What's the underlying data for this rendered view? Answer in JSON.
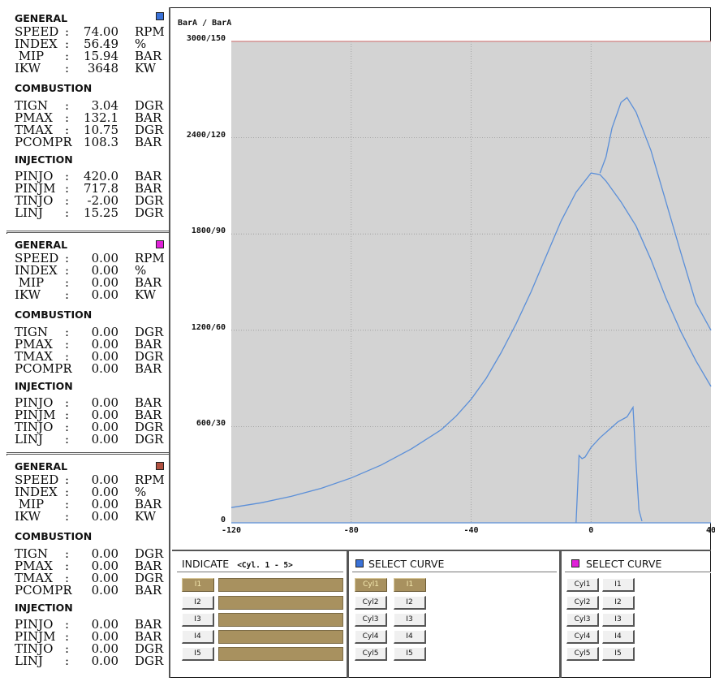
{
  "panels": [
    {
      "color": "#3a72d8",
      "general_label": "GENERAL",
      "general": [
        {
          "name": "SPEED",
          "value": "74.00",
          "unit": "RPM"
        },
        {
          "name": "INDEX",
          "value": "56.49",
          "unit": "%"
        },
        {
          "name": " MIP",
          "value": "15.94",
          "unit": "BAR"
        },
        {
          "name": "IKW",
          "value": "3648",
          "unit": "KW"
        }
      ],
      "combustion_label": "COMBUSTION",
      "combustion": [
        {
          "name": "TIGN",
          "value": "3.04",
          "unit": "DGR"
        },
        {
          "name": "PMAX",
          "value": "132.1",
          "unit": "BAR"
        },
        {
          "name": "TMAX",
          "value": "10.75",
          "unit": "DGR"
        },
        {
          "name": "PCOMPR",
          "value": "108.3",
          "unit": "BAR"
        }
      ],
      "injection_label": "INJECTION",
      "injection": [
        {
          "name": "PINJO",
          "value": "420.0",
          "unit": "BAR"
        },
        {
          "name": "PINJM",
          "value": "717.8",
          "unit": "BAR"
        },
        {
          "name": "TINJO",
          "value": "-2.00",
          "unit": "DGR"
        },
        {
          "name": "LINJ",
          "value": "15.25",
          "unit": "DGR"
        }
      ]
    },
    {
      "color": "#e020d8",
      "general_label": "GENERAL",
      "general": [
        {
          "name": "SPEED",
          "value": "0.00",
          "unit": "RPM"
        },
        {
          "name": "INDEX",
          "value": "0.00",
          "unit": "%"
        },
        {
          "name": " MIP",
          "value": "0.00",
          "unit": "BAR"
        },
        {
          "name": "IKW",
          "value": "0.00",
          "unit": "KW"
        }
      ],
      "combustion_label": "COMBUSTION",
      "combustion": [
        {
          "name": "TIGN",
          "value": "0.00",
          "unit": "DGR"
        },
        {
          "name": "PMAX",
          "value": "0.00",
          "unit": "BAR"
        },
        {
          "name": "TMAX",
          "value": "0.00",
          "unit": "DGR"
        },
        {
          "name": "PCOMPR",
          "value": "0.00",
          "unit": "BAR"
        }
      ],
      "injection_label": "INJECTION",
      "injection": [
        {
          "name": "PINJO",
          "value": "0.00",
          "unit": "BAR"
        },
        {
          "name": "PINJM",
          "value": "0.00",
          "unit": "BAR"
        },
        {
          "name": "TINJO",
          "value": "0.00",
          "unit": "DGR"
        },
        {
          "name": "LINJ",
          "value": "0.00",
          "unit": "DGR"
        }
      ]
    },
    {
      "color": "#b05040",
      "general_label": "GENERAL",
      "general": [
        {
          "name": "SPEED",
          "value": "0.00",
          "unit": "RPM"
        },
        {
          "name": "INDEX",
          "value": "0.00",
          "unit": "%"
        },
        {
          "name": " MIP",
          "value": "0.00",
          "unit": "BAR"
        },
        {
          "name": "IKW",
          "value": "0.00",
          "unit": "KW"
        }
      ],
      "combustion_label": "COMBUSTION",
      "combustion": [
        {
          "name": "TIGN",
          "value": "0.00",
          "unit": "DGR"
        },
        {
          "name": "PMAX",
          "value": "0.00",
          "unit": "BAR"
        },
        {
          "name": "TMAX",
          "value": "0.00",
          "unit": "DGR"
        },
        {
          "name": "PCOMPR",
          "value": "0.00",
          "unit": "BAR"
        }
      ],
      "injection_label": "INJECTION",
      "injection": [
        {
          "name": "PINJO",
          "value": "0.00",
          "unit": "BAR"
        },
        {
          "name": "PINJM",
          "value": "0.00",
          "unit": "BAR"
        },
        {
          "name": "TINJO",
          "value": "0.00",
          "unit": "DGR"
        },
        {
          "name": "LINJ",
          "value": "0.00",
          "unit": "DGR"
        }
      ]
    }
  ],
  "chart_data": {
    "type": "line",
    "ylabel": "BarA / BarA",
    "y_tick_labels": [
      "0",
      "600/30",
      "1200/60",
      "1800/90",
      "2400/120",
      "3000/150"
    ],
    "y_tick_values": [
      0,
      600,
      1200,
      1800,
      2400,
      3000
    ],
    "x_tick_labels": [
      "-120",
      "-80",
      "-40",
      "0",
      "40"
    ],
    "xlim": [
      -120,
      40
    ],
    "ylim": [
      0,
      3000
    ],
    "grid": true,
    "plot_background": "#d3d3d3",
    "top_line_color": "#d08080",
    "line_color": "#5b8fd8",
    "series": [
      {
        "x": [
          -120,
          -110,
          -100,
          -90,
          -80,
          -70,
          -60,
          -50,
          -45,
          -40,
          -35,
          -30,
          -25,
          -20,
          -15,
          -10,
          -5,
          0,
          3,
          5,
          10,
          15,
          20,
          25,
          30,
          35,
          40
        ],
        "values": [
          95,
          125,
          165,
          215,
          280,
          360,
          460,
          580,
          665,
          770,
          900,
          1060,
          1240,
          1440,
          1660,
          1880,
          2060,
          2180,
          2170,
          2130,
          2000,
          1850,
          1640,
          1400,
          1190,
          1010,
          850
        ]
      },
      {
        "x": [
          3,
          5,
          7,
          10,
          12,
          15,
          20,
          25,
          30,
          35,
          40
        ],
        "values": [
          2180,
          2280,
          2460,
          2620,
          2650,
          2560,
          2320,
          2000,
          1680,
          1370,
          1200
        ]
      },
      {
        "x": [
          -5,
          -4,
          -3,
          -2,
          0,
          3,
          6,
          9,
          12,
          13,
          14,
          15,
          16,
          17
        ],
        "values": [
          0,
          420,
          400,
          410,
          470,
          530,
          580,
          630,
          660,
          690,
          720,
          370,
          80,
          10
        ]
      }
    ]
  },
  "indicate": {
    "title": "INDICATE",
    "range": "<Cyl. 1 - 5>",
    "buttons": [
      "I1",
      "I2",
      "I3",
      "I4",
      "I5"
    ],
    "active": "I1"
  },
  "select_curve_1": {
    "title": "SELECT CURVE",
    "color": "#3a72d8",
    "cyl_buttons": [
      "Cyl1",
      "Cyl2",
      "Cyl3",
      "Cyl4",
      "Cyl5"
    ],
    "i_buttons": [
      "I1",
      "I2",
      "I3",
      "I4",
      "I5"
    ],
    "active_cyl": "Cyl1",
    "active_i": "I1"
  },
  "select_curve_2": {
    "title": "SELECT CURVE",
    "color": "#e020d8",
    "cyl_buttons": [
      "Cyl1",
      "Cyl2",
      "Cyl3",
      "Cyl4",
      "Cyl5"
    ],
    "i_buttons": [
      "I1",
      "I2",
      "I3",
      "I4",
      "I5"
    ]
  }
}
